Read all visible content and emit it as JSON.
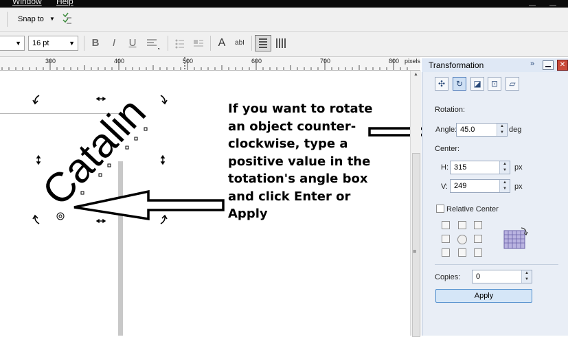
{
  "menubar": {
    "items": [
      "Window",
      "Help"
    ]
  },
  "toolbar": {
    "snap_label": "Snap to",
    "font_size": "16 pt",
    "bold_icon": "bold-icon",
    "italic_icon": "italic-icon",
    "underline_icon": "underline-icon"
  },
  "ruler": {
    "labels": [
      "300",
      "400",
      "500",
      "600",
      "700",
      "800"
    ],
    "unit": "pixels"
  },
  "canvas": {
    "rotated_text": "Catalin"
  },
  "annotation": {
    "text": "If you want to rotate\nan object counter-\nclockwise, type a\npositive value in the\ntotation's angle box\n and click Enter or\nApply"
  },
  "docker": {
    "title": "Transformation",
    "rotation_label": "Rotation:",
    "angle_label": "Angle:",
    "angle_value": "45.0",
    "angle_unit": "deg",
    "center_label": "Center:",
    "h_label": "H:",
    "h_value": "315",
    "h_unit": "px",
    "v_label": "V:",
    "v_value": "249",
    "v_unit": "px",
    "relative_center_label": "Relative Center",
    "relative_center_checked": false,
    "copies_label": "Copies:",
    "copies_value": "0",
    "apply_label": "Apply"
  },
  "colors": {
    "docker_bg": "#e9eef6",
    "apply_button": "#d5e6f7",
    "accent": "#2a4a7a"
  }
}
